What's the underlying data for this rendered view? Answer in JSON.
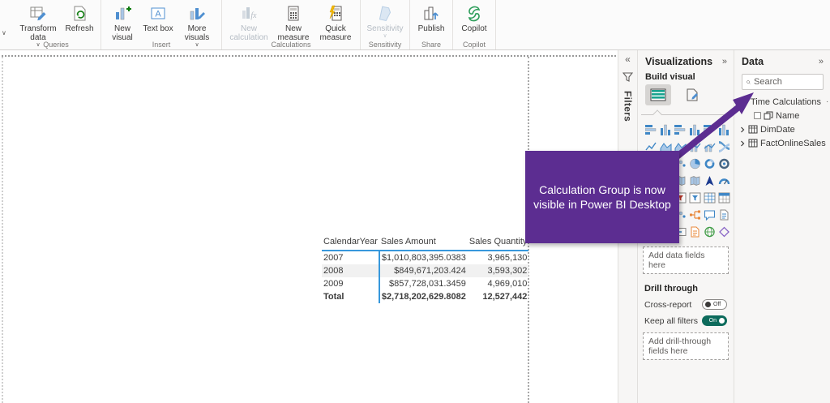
{
  "ribbon": {
    "groups": [
      {
        "label": "Queries",
        "buttons": [
          {
            "label": "Transform data",
            "chevron": true
          },
          {
            "label": "Refresh"
          }
        ]
      },
      {
        "label": "Insert",
        "buttons": [
          {
            "label": "New visual"
          },
          {
            "label": "Text box"
          },
          {
            "label": "More visuals",
            "chevron": true
          }
        ]
      },
      {
        "label": "Calculations",
        "buttons": [
          {
            "label": "New calculation",
            "disabled": true
          },
          {
            "label": "New measure"
          },
          {
            "label": "Quick measure"
          }
        ]
      },
      {
        "label": "Sensitivity",
        "buttons": [
          {
            "label": "Sensitivity",
            "disabled": true,
            "chevron": true
          }
        ]
      },
      {
        "label": "Share",
        "buttons": [
          {
            "label": "Publish"
          }
        ]
      },
      {
        "label": "Copilot",
        "buttons": [
          {
            "label": "Copilot"
          }
        ]
      }
    ]
  },
  "callout": {
    "text": "Calculation Group is now visible in Power BI Desktop",
    "bg_color": "#5c2d91"
  },
  "table_visual": {
    "columns": [
      "CalendarYear",
      "Sales Amount",
      "Sales Quantity"
    ],
    "rows": [
      [
        "2007",
        "$1,010,803,395.0383",
        "3,965,130"
      ],
      [
        "2008",
        "$849,671,203.424",
        "3,593,302"
      ],
      [
        "2009",
        "$857,728,031.3459",
        "4,969,010"
      ]
    ],
    "total": [
      "Total",
      "$2,718,202,629.8082",
      "12,527,442"
    ],
    "accent_color": "#3798dc"
  },
  "filters_pane": {
    "title": "Filters"
  },
  "visualizations": {
    "title": "Visualizations",
    "build_visual_label": "Build visual",
    "add_data_fields": "Add data fields here",
    "drill_through_label": "Drill through",
    "cross_report_label": "Cross-report",
    "cross_report_state": "Off",
    "keep_all_filters_label": "Keep all filters",
    "keep_all_filters_state": "On",
    "add_drill_fields": "Add drill-through fields here",
    "toggle_on_color": "#0d6b5c",
    "icons": [
      {
        "name": "stacked-bar-chart",
        "k": "barsH"
      },
      {
        "name": "stacked-column-chart",
        "k": "barsV"
      },
      {
        "name": "clustered-bar-chart",
        "k": "barsH"
      },
      {
        "name": "clustered-column-chart",
        "k": "barsV"
      },
      {
        "name": "100-stacked-bar-chart",
        "k": "barsH"
      },
      {
        "name": "100-stacked-column-chart",
        "k": "barsV"
      },
      {
        "name": "line-chart",
        "k": "line"
      },
      {
        "name": "area-chart",
        "k": "area"
      },
      {
        "name": "stacked-area-chart",
        "k": "area"
      },
      {
        "name": "line-stacked-column-chart",
        "k": "combo"
      },
      {
        "name": "line-clustered-column-chart",
        "k": "combo"
      },
      {
        "name": "ribbon-chart",
        "k": "ribbon"
      },
      {
        "name": "waterfall-chart",
        "k": "waterfall"
      },
      {
        "name": "funnel-chart",
        "k": "funnel"
      },
      {
        "name": "scatter-chart",
        "k": "dots"
      },
      {
        "name": "pie-chart",
        "k": "pie"
      },
      {
        "name": "donut-chart",
        "k": "donut"
      },
      {
        "name": "treemap",
        "k": "ring"
      },
      {
        "name": "map",
        "k": "grid"
      },
      {
        "name": "filled-map",
        "k": "map"
      },
      {
        "name": "shape-map",
        "k": "map"
      },
      {
        "name": "azure-map",
        "k": "map"
      },
      {
        "name": "azure-map-visual",
        "k": "arrow",
        "c": "#1b3a8f"
      },
      {
        "name": "gauge",
        "k": "gauge"
      },
      {
        "name": "card",
        "k": "card"
      },
      {
        "name": "multi-row-card",
        "k": "card"
      },
      {
        "name": "kpi",
        "k": "slicer",
        "c": "#c0392b"
      },
      {
        "name": "slicer",
        "k": "slicer"
      },
      {
        "name": "table",
        "k": "grid"
      },
      {
        "name": "matrix",
        "k": "gridH"
      },
      {
        "name": "r-script-visual",
        "k": "page"
      },
      {
        "name": "python-visual",
        "k": "page"
      },
      {
        "name": "key-influencers",
        "k": "dots"
      },
      {
        "name": "decomposition-tree",
        "k": "tree",
        "c": "#e8883a"
      },
      {
        "name": "qa-visual",
        "k": "bubble"
      },
      {
        "name": "smart-narrative",
        "k": "page"
      },
      {
        "name": "metrics",
        "k": "page"
      },
      {
        "name": "paginated-report",
        "k": "page"
      },
      {
        "name": "power-apps",
        "k": "card"
      },
      {
        "name": "paginated-report-visual",
        "k": "pageO",
        "c": "#e8883a"
      },
      {
        "name": "arcgis-map",
        "k": "globe",
        "c": "#3f9c46"
      },
      {
        "name": "power-automate",
        "k": "diamond",
        "c": "#8661c5"
      }
    ]
  },
  "data_pane": {
    "title": "Data",
    "search_placeholder": "Search",
    "items": [
      {
        "label": "Time Calculations",
        "type": "calculation-group",
        "expanded": true
      },
      {
        "label": "Name",
        "type": "calculation-item",
        "checked": false
      },
      {
        "label": "DimDate",
        "type": "table",
        "expanded": false
      },
      {
        "label": "FactOnlineSales",
        "type": "table",
        "expanded": false
      }
    ]
  }
}
